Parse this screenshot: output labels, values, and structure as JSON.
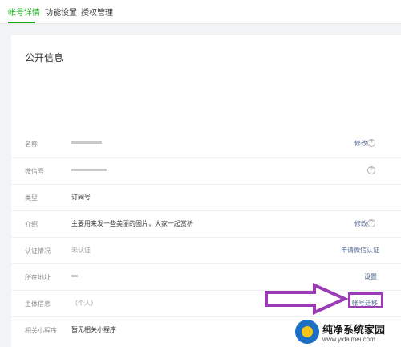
{
  "tabs": [
    {
      "label": "帐号详情",
      "active": true
    },
    {
      "label": "功能设置",
      "active": false
    },
    {
      "label": "授权管理",
      "active": false
    }
  ],
  "panel": {
    "title": "公开信息"
  },
  "rows": [
    {
      "label": "名称",
      "value": "",
      "action": "修改",
      "help": true
    },
    {
      "label": "微信号",
      "value": "",
      "action": "",
      "help": true
    },
    {
      "label": "类型",
      "value": "订阅号",
      "action": "",
      "help": false
    },
    {
      "label": "介绍",
      "value": "主要用来发一些美丽的图片，大家一起赏析",
      "action": "修改",
      "help": true
    },
    {
      "label": "认证情况",
      "value": "未认证",
      "action": "申请微信认证",
      "help": false
    },
    {
      "label": "所在地址",
      "value": "",
      "action": "设置",
      "help": false
    },
    {
      "label": "主体信息",
      "value": "（个人）",
      "action": "帐号迁移",
      "help": false
    },
    {
      "label": "相关小程序",
      "value": "暂无相关小程序",
      "action": "",
      "help": false
    }
  ],
  "help_glyph": "?",
  "watermark": {
    "title": "纯净系统家园",
    "url": "www.yidaimei.com"
  },
  "colors": {
    "accent": "#1aad19",
    "link": "#576b95",
    "annotation": "#9b3bb5"
  }
}
